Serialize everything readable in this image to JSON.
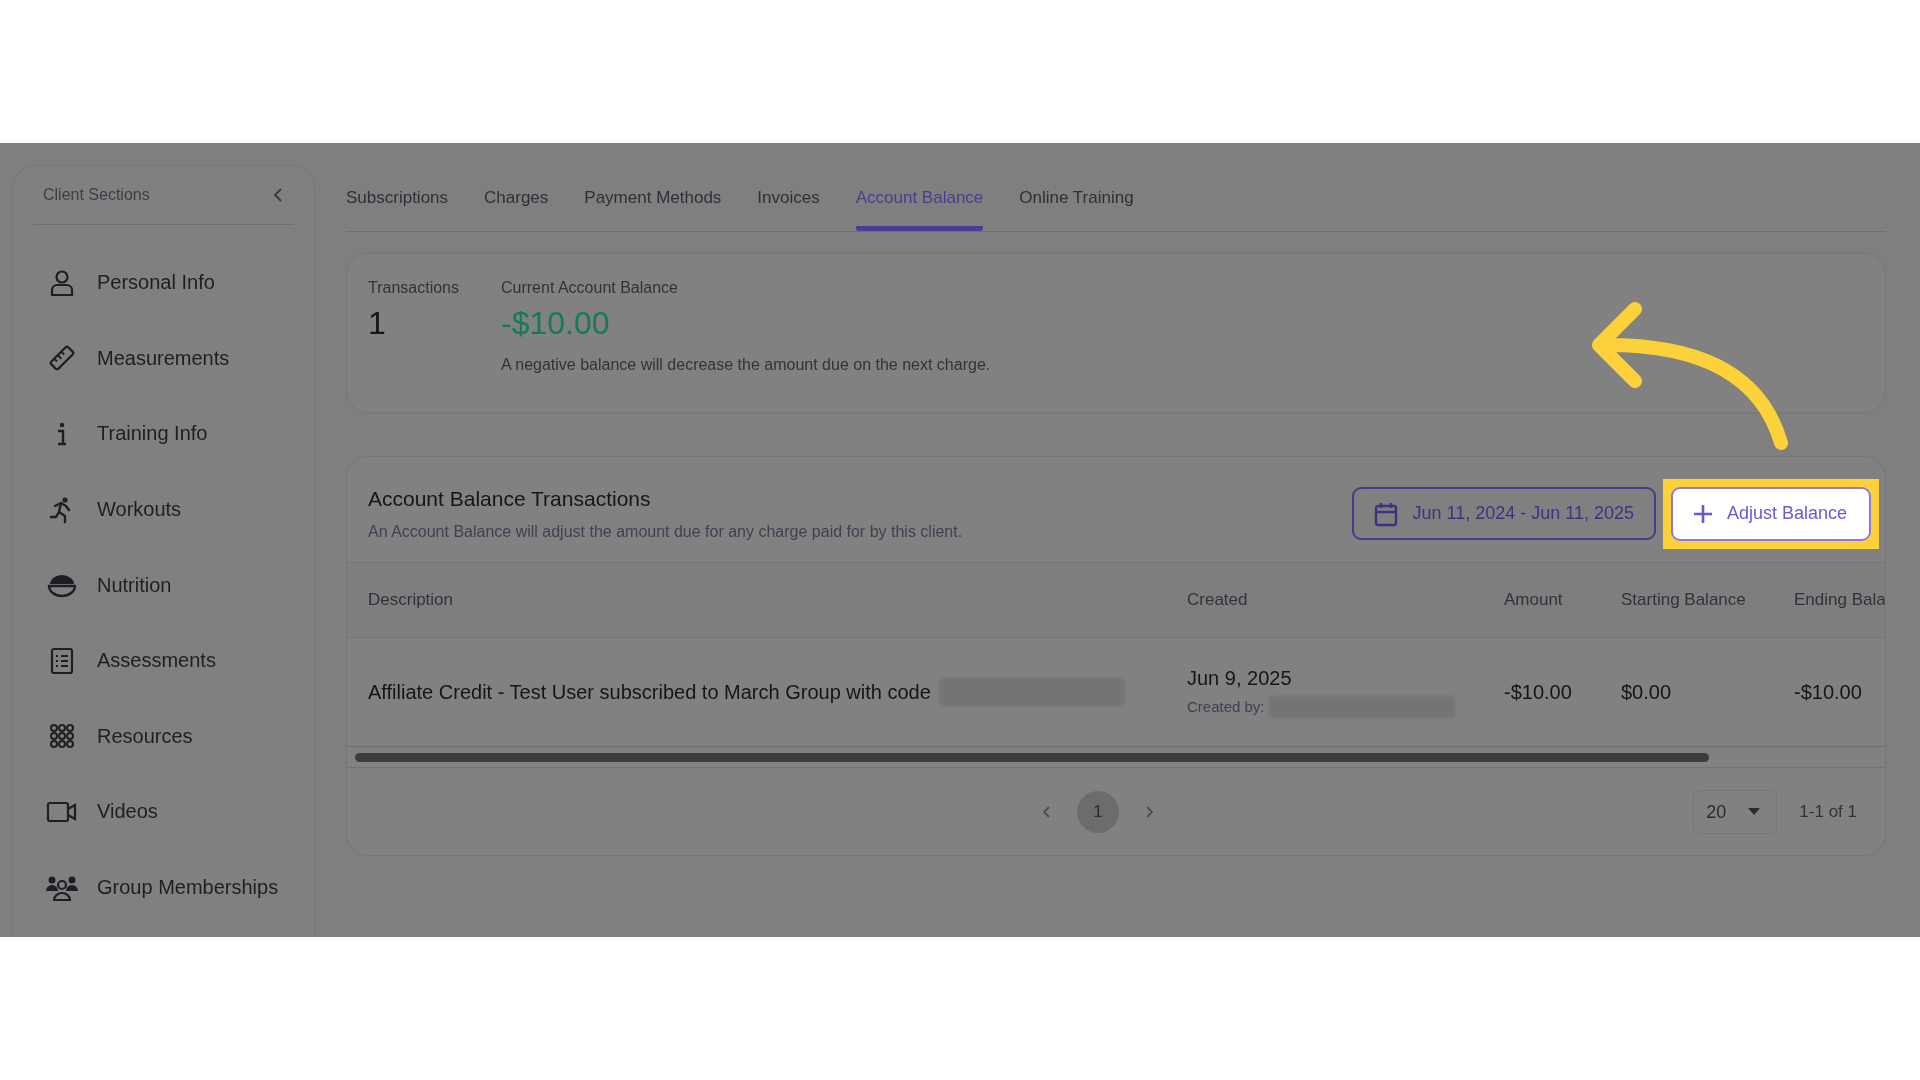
{
  "sidebar": {
    "title": "Client Sections",
    "items": [
      {
        "label": "Personal Info"
      },
      {
        "label": "Measurements"
      },
      {
        "label": "Training Info"
      },
      {
        "label": "Workouts"
      },
      {
        "label": "Nutrition"
      },
      {
        "label": "Assessments"
      },
      {
        "label": "Resources"
      },
      {
        "label": "Videos"
      },
      {
        "label": "Group Memberships"
      }
    ]
  },
  "tabs": [
    {
      "label": "Subscriptions",
      "selected": false
    },
    {
      "label": "Charges",
      "selected": false
    },
    {
      "label": "Payment Methods",
      "selected": false
    },
    {
      "label": "Invoices",
      "selected": false
    },
    {
      "label": "Account Balance",
      "selected": true
    },
    {
      "label": "Online Training",
      "selected": false
    }
  ],
  "summary": {
    "transactions_label": "Transactions",
    "transactions_count": "1",
    "balance_label": "Current Account Balance",
    "balance_value": "-$10.00",
    "balance_note": "A negative balance will decrease the amount due on the next charge."
  },
  "transactions": {
    "title": "Account Balance Transactions",
    "subtitle": "An Account Balance will adjust the amount due for any charge paid for by this client.",
    "date_range": "Jun 11, 2024 - Jun 11, 2025",
    "adjust_button": {
      "label": "Adjust Balance",
      "highlighted": true
    },
    "table": {
      "columns": [
        "Description",
        "Created",
        "Amount",
        "Starting Balance",
        "Ending Bala"
      ],
      "rows": [
        {
          "description": "Affiliate Credit - Test User subscribed to March Group with code",
          "created": "Jun 9, 2025",
          "created_by_label": "Created by:",
          "amount": "-$10.00",
          "starting_balance": "$0.00",
          "ending_balance": "-$10.00"
        }
      ]
    },
    "pagination": {
      "pages": [
        {
          "label": "1",
          "selected": true
        }
      ],
      "page_size": "20",
      "range": "1-1 of 1"
    }
  }
}
